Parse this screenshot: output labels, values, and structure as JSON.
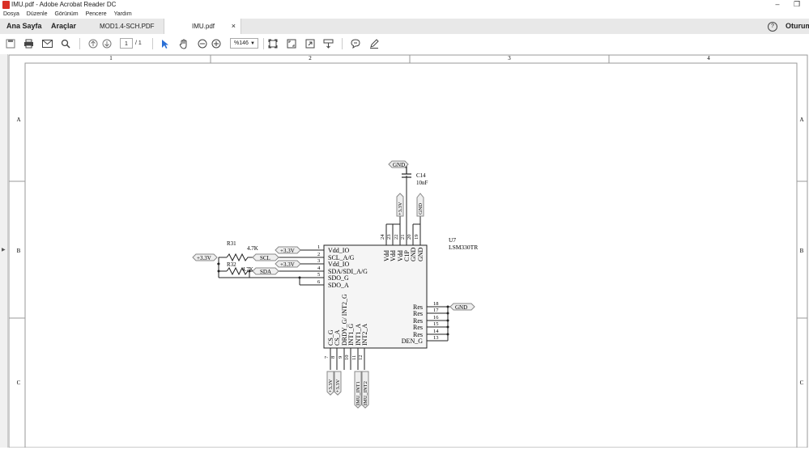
{
  "window": {
    "title": "IMU.pdf - Adobe Acrobat Reader DC",
    "minimize": "–",
    "restore": "❐"
  },
  "menu": [
    "Dosya",
    "Düzenle",
    "Görünüm",
    "Pencere",
    "Yardım"
  ],
  "tabs": {
    "home": "Ana Sayfa",
    "tools": "Araçlar",
    "doc1": "MOD1.4-SCH.PDF",
    "doc2": "IMU.pdf",
    "close": "×"
  },
  "account": {
    "help": "?",
    "signin": "Oturum"
  },
  "toolbar": {
    "page_current": "1",
    "page_total": "/ 1",
    "zoom": "%146",
    "icons": [
      "save-icon",
      "print-icon",
      "email-icon",
      "search-icon",
      "page-up-icon",
      "page-down-icon",
      "select-arrow-icon",
      "hand-icon",
      "zoom-out-icon",
      "zoom-in-icon",
      "fit-page-icon",
      "full-screen-icon",
      "rotate-icon",
      "scroll-mode-icon",
      "comment-icon",
      "sign-icon"
    ]
  },
  "schematic": {
    "columns": [
      "1",
      "2",
      "3",
      "4"
    ],
    "rows": [
      "A",
      "B",
      "C"
    ],
    "chip": {
      "ref": "U7",
      "part": "LSM330TR"
    },
    "left_pins": [
      {
        "num": "1",
        "name": "Vdd_IO"
      },
      {
        "num": "2",
        "name": "SCL_A/G"
      },
      {
        "num": "3",
        "name": "Vdd_IO"
      },
      {
        "num": "4",
        "name": "SDA/SDI_A/G"
      },
      {
        "num": "5",
        "name": "SDO_G"
      },
      {
        "num": "6",
        "name": "SDO_A"
      }
    ],
    "top_pins": [
      {
        "num": "24",
        "name": "Vdd"
      },
      {
        "num": "23",
        "name": "Vdd"
      },
      {
        "num": "22",
        "name": "Vdd"
      },
      {
        "num": "21",
        "name": "C1P"
      },
      {
        "num": "20",
        "name": "GND"
      },
      {
        "num": "19",
        "name": "GND"
      }
    ],
    "right_pins": [
      {
        "num": "18",
        "name": "Res"
      },
      {
        "num": "17",
        "name": "Res"
      },
      {
        "num": "16",
        "name": "Res"
      },
      {
        "num": "15",
        "name": "Res"
      },
      {
        "num": "14",
        "name": "Res"
      },
      {
        "num": "13",
        "name": "DEN_G"
      }
    ],
    "bottom_pins": [
      {
        "num": "7",
        "name": "CS_G"
      },
      {
        "num": "8",
        "name": "CS_A"
      },
      {
        "num": "9",
        "name": "DRDY_G/ INT2_G"
      },
      {
        "num": "10",
        "name": "INT1_G"
      },
      {
        "num": "11",
        "name": "INT1_A"
      },
      {
        "num": "12",
        "name": "INT2_A"
      }
    ],
    "resistors": [
      {
        "ref": "R31",
        "value": "4.7K"
      },
      {
        "ref": "R32",
        "value": "4.7K"
      }
    ],
    "capacitor": {
      "ref": "C14",
      "value": "10nF"
    },
    "nets": {
      "gnd": "GND",
      "v33": "+3.3V",
      "scl": "SCL",
      "sda": "SDA",
      "int1": "IMU_INT1",
      "int2": "IMU_INT2"
    }
  }
}
